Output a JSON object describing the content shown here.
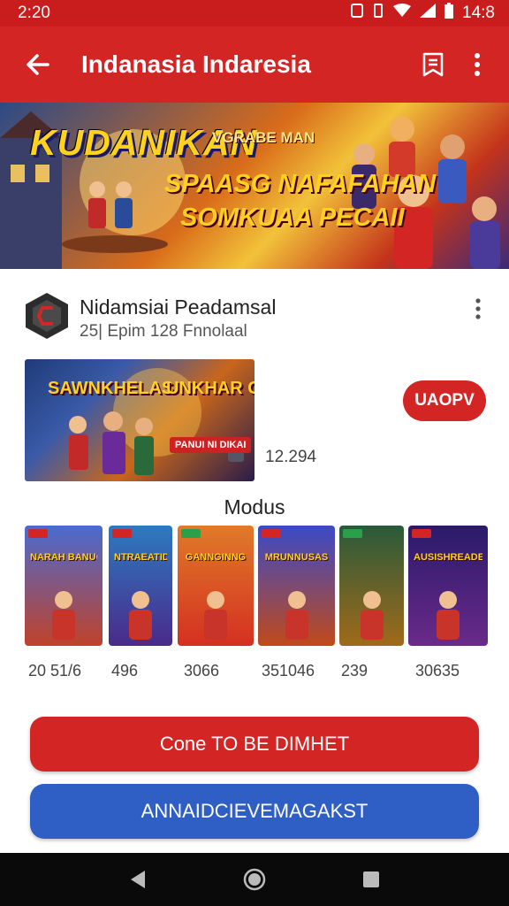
{
  "status_bar": {
    "time": "2:20",
    "clock_right": "14:8",
    "icons": [
      "nfc-icon",
      "vibrate-icon",
      "wifi-icon",
      "signal-icon",
      "battery-icon"
    ]
  },
  "app_bar": {
    "title": "Indanasia Indaresia",
    "icons": [
      "back-arrow-icon",
      "bookmark-icon",
      "more-vert-icon"
    ]
  },
  "banner": {
    "title": "KUDANIKAN",
    "sub1": "VGRABE MAN",
    "sub2": "SPAASG NAFAFAHAN",
    "sub3": "SOMKUAA PECAII"
  },
  "publisher": {
    "name": "Nidamsiai Peadamsal",
    "meta": "25| Epim 128 Fnnolaal"
  },
  "featured": {
    "text1": "SAWNKHELAS",
    "text2": "UNKHAR CLOCKUS",
    "tag": "PANUI NI DIKAI",
    "count": "12.294",
    "install_label": "UAOPV"
  },
  "section": {
    "title": "Modus"
  },
  "cards": [
    {
      "title": "NARAH BANUOS",
      "count": "20 51/6",
      "color_top": "#4a6bd0",
      "color_bottom": "#c0422a",
      "badge": "#d42525"
    },
    {
      "title": "NTRAEATIDA",
      "count": "496",
      "color_top": "#2d7ac0",
      "color_bottom": "#4a2a8a",
      "badge": "#d42525"
    },
    {
      "title": "GANNGINNG",
      "count": "3066",
      "color_top": "#e07a2a",
      "color_bottom": "#d43020",
      "badge": "#2aa04a"
    },
    {
      "title": "MRUNNUSAS",
      "count": "351046",
      "color_top": "#3a4ac8",
      "color_bottom": "#c04a1a",
      "badge": "#d42525"
    },
    {
      "title": "",
      "count": "239",
      "color_top": "#2a5a3a",
      "color_bottom": "#a06a1a",
      "badge": "#2aa04a"
    },
    {
      "title": "AUSISHREADE DINADOSTUS",
      "count": "30635",
      "color_top": "#2a1a6a",
      "color_bottom": "#6a2a8a",
      "badge": "#d42525"
    }
  ],
  "buttons": {
    "primary": "Cone TO BE DIMHET",
    "secondary": "ANNAIDCIEVEMAGAKST"
  },
  "nav": {
    "icons": [
      "nav-back-icon",
      "nav-home-icon",
      "nav-recents-icon"
    ]
  }
}
